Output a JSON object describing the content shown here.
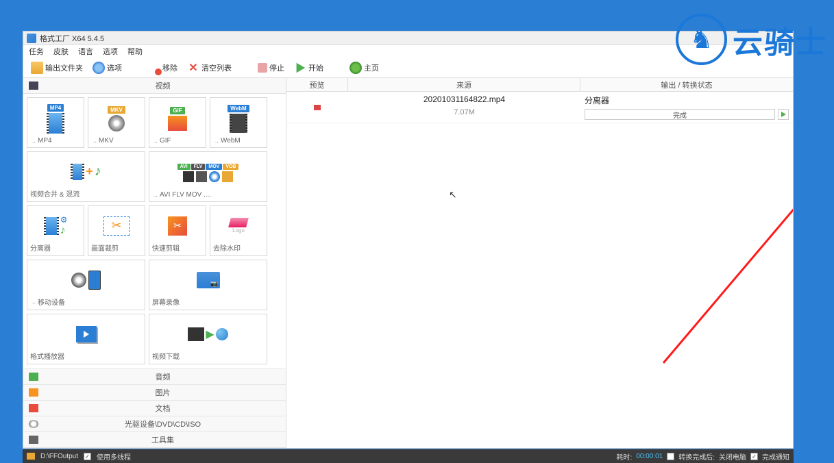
{
  "watermark": {
    "text": "云骑士"
  },
  "window": {
    "title": "格式工厂 X64 5.4.5"
  },
  "menu": {
    "task": "任务",
    "skin": "皮肤",
    "language": "语言",
    "option": "选项",
    "help": "帮助"
  },
  "toolbar": {
    "output_folder": "输出文件夹",
    "options": "选项",
    "remove": "移除",
    "clear_list": "清空列表",
    "stop": "停止",
    "start": "开始",
    "home": "主页"
  },
  "sidebar": {
    "video_header": "视频",
    "tiles": {
      "mp4": "MP4",
      "mkv": "MKV",
      "gif": "GIF",
      "webm": "WebM",
      "merge": "视频合并 & 混流",
      "aviflv": "AVI FLV MOV ....",
      "separator": "分离器",
      "crop": "画面裁剪",
      "quickcut": "快速剪辑",
      "watermark": "去除水印",
      "mobile": "移动设备",
      "screenrec": "屏幕录像",
      "player": "格式播放器",
      "download": "视频下载",
      "logo": "Logo"
    },
    "badges": {
      "mp4": "MP4",
      "mkv": "MKV",
      "gif": "GIF",
      "webm": "WebM",
      "avi": "AVI",
      "flv": "FLV",
      "mov": "MOV",
      "vob": "VOB"
    },
    "categories": {
      "audio": "音频",
      "image": "图片",
      "document": "文档",
      "rom": "光驱设备\\DVD\\CD\\ISO",
      "toolset": "工具集"
    }
  },
  "list": {
    "header": {
      "preview": "预览",
      "source": "来源",
      "output": "输出 / 转换状态"
    },
    "row": {
      "filename": "20201031164822.mp4",
      "filesize": "7.07M",
      "operation": "分离器",
      "status": "完成"
    }
  },
  "statusbar": {
    "output_path": "D:\\FFOutput",
    "multithread": "使用多线程",
    "elapsed_label": "耗时:",
    "elapsed_time": "00:00:01",
    "after_label": "转换完成后:",
    "shutdown": "关闭电脑",
    "notify": "完成通知"
  }
}
